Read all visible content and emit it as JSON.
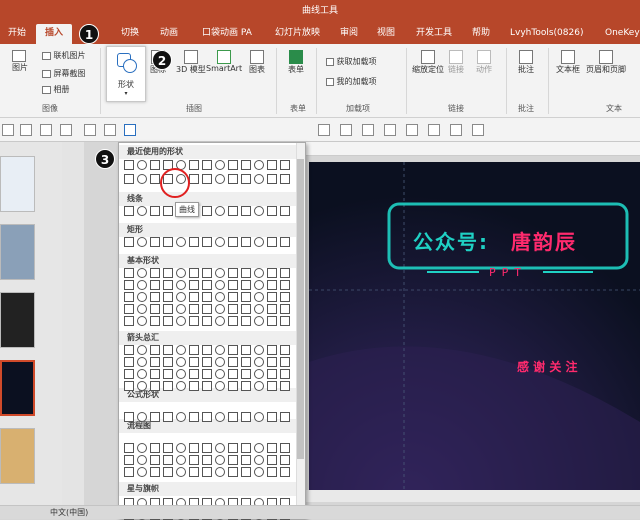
{
  "window": {
    "title": "曲线工具"
  },
  "tabs": [
    "开始",
    "插入",
    "切换",
    "动画",
    "口袋动画 PA",
    "幻灯片放映",
    "审阅",
    "视图",
    "开发工具",
    "帮助",
    "LvyhTools(0826)",
    "OneKey"
  ],
  "ribbon": {
    "buttons": {
      "picture": "图片",
      "online_picture": "联机图片",
      "screenshot": "屏幕截图",
      "album": "相册",
      "shapes": "形状",
      "icons": "图标",
      "models_3d": "3D 模型",
      "smartart": "SmartArt",
      "chart": "图表",
      "form": "表单",
      "get_addins": "获取加载项",
      "my_addins": "我的加载项",
      "zoom": "缩放定位",
      "link": "链接",
      "action": "动作",
      "comment": "批注",
      "textbox": "文本框",
      "header_footer": "页眉和页脚"
    },
    "groups": [
      "图像",
      "插图",
      "表单",
      "加载项",
      "链接",
      "批注",
      "文本"
    ]
  },
  "badges": [
    "1",
    "2",
    "3"
  ],
  "dropdown": {
    "sections": [
      "最近使用的形状",
      "线条",
      "矩形",
      "基本形状",
      "箭头总汇",
      "公式形状",
      "流程图",
      "星与旗帜"
    ],
    "tooltip": "曲线"
  },
  "slide": {
    "title_left": "公众号:",
    "title_right": "唐韵辰",
    "subtitle": "PPT",
    "thanks": "感 谢 关 注"
  },
  "statusbar": {
    "language": "中文(中国)"
  },
  "colors": {
    "accent": "#b7472a",
    "neon_teal": "#1fd1c4",
    "neon_pink": "#ff2a6d"
  }
}
